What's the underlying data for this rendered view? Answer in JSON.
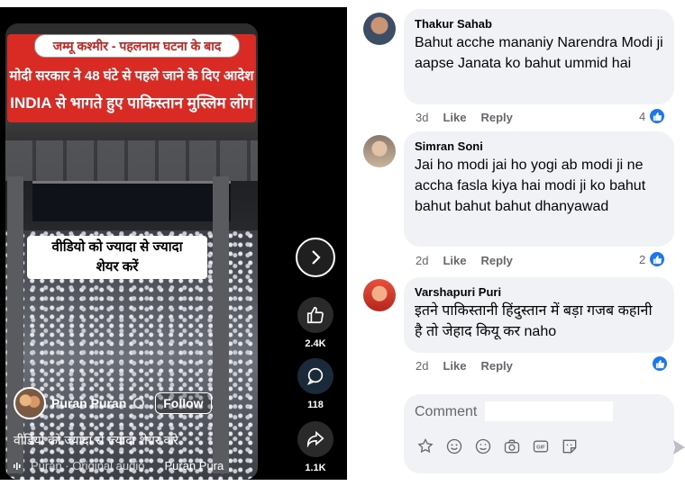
{
  "reel": {
    "banner_top": "जम्मू कश्मीर - पहलनाम घटना के बाद",
    "banner_dots": "...",
    "banner_line1": "मोदी सरकार ने 48 घंटे से पहले जाने के दिए आदेश",
    "banner_line2": "INDIA से भागते हुए पाकिस्तान मुस्लिम लोग",
    "sticker_line1": "वीडियो को ज्यादा से ज्यादा",
    "sticker_line2": "शेयर करें",
    "author": "Puran Puran",
    "follow_label": "Follow",
    "caption": "वीडियो को ज्यादा से ज्यादा शेयर करे",
    "audio_text": "Puran · Original audio",
    "audio_author": "Puran Pura",
    "likes": "2.4K",
    "comments": "118",
    "shares": "1.1K"
  },
  "comments": [
    {
      "name": "Thakur Sahab",
      "text": "Bahut acche mananiy Narendra Modi ji aapse Janata ko bahut ummid hai",
      "time": "3d",
      "like": "Like",
      "reply": "Reply",
      "reactions": "4"
    },
    {
      "name": "Simran Soni",
      "text": "Jai ho modi jai ho yogi ab modi ji ne accha fasla kiya hai modi ji ko bahut bahut bahut bahut dhanyawad",
      "time": "2d",
      "like": "Like",
      "reply": "Reply",
      "reactions": "2"
    },
    {
      "name": "Varshapuri Puri",
      "text": "इतने पाकिस्तानी हिंदुस्तान में बड़ा गजब कहानी है तो जेहाद कियू कर naho",
      "time": "2d",
      "like": "Like",
      "reply": "Reply",
      "reactions": ""
    }
  ],
  "composer": {
    "placeholder": "Comment"
  },
  "colors": {
    "accent": "#1877f2",
    "bubble": "#f0f2f5",
    "banner": "#d92b24"
  },
  "icons": [
    "chevron-right-icon",
    "thumbs-up-icon",
    "comment-icon",
    "share-icon",
    "avatar-icon",
    "emoji-icon",
    "camera-icon",
    "gif-icon",
    "sticker-icon",
    "send-icon"
  ]
}
